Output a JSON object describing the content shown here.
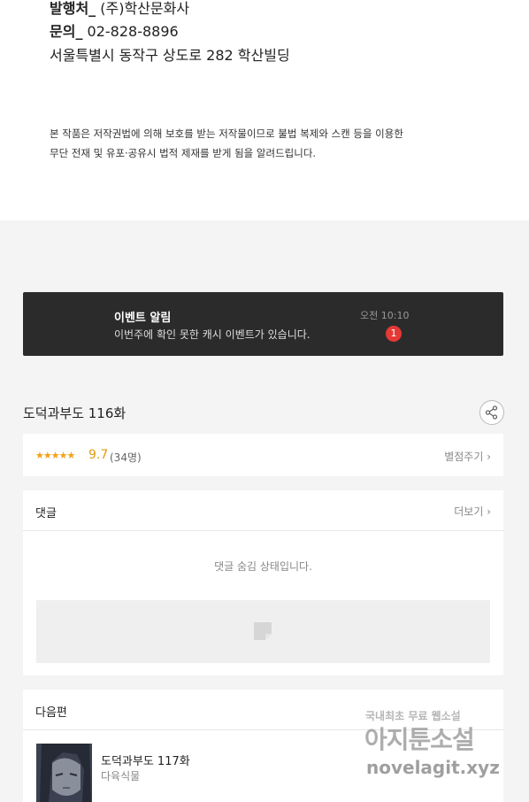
{
  "publisher": {
    "publisher_label": "발행처_",
    "publisher_value": "(주)학산문화사",
    "contact_label": "문의_",
    "contact_value": "02-828-8896",
    "address": "서울특별시 동작구 상도로 282 학산빌딩"
  },
  "copyright": {
    "line1": "본 작품은 저작권법에 의해 보호를 받는 저작물이므로 불법 복제와 스캔 등을 이용한",
    "line2": "무단 전재 및 유포·공유시 법적 제재를 받게 됨을 알려드립니다."
  },
  "event": {
    "title": "이벤트 알림",
    "message": "이번주에 확인 못한 캐시 이벤트가 있습니다.",
    "time": "오전 10:10",
    "badge": "1"
  },
  "episode": {
    "title": "도덕과부도 116화",
    "share_icon": "share-icon"
  },
  "rating": {
    "stars": "★★★★★",
    "score": "9.7",
    "count": "(34명)",
    "link": "별점주기 ›"
  },
  "comments": {
    "header": "댓글",
    "more": "더보기 ›",
    "hidden_message": "댓글 숨김 상태입니다."
  },
  "next": {
    "header": "다음편",
    "title": "도덕과부도 117화",
    "author": "다육식물"
  },
  "watermark": {
    "line1": "국내최초 무료 웹소설",
    "line2": "아지툰소설",
    "line3": "novelagit.xyz"
  }
}
